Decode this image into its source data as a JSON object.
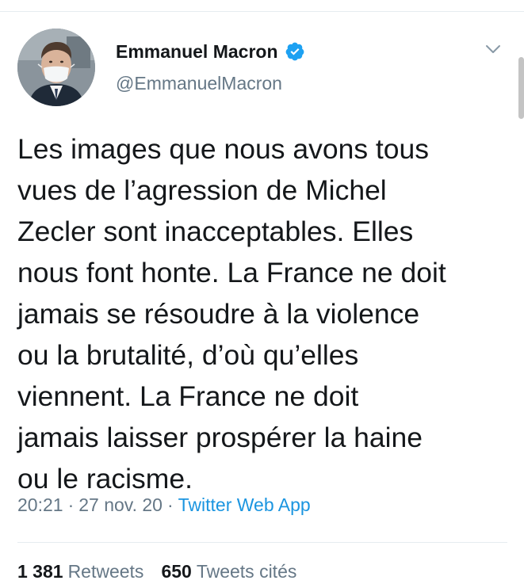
{
  "colors": {
    "link": "#1b95e0",
    "secondary_text": "#657786",
    "primary_text": "#14171a",
    "divider": "#e6ecf0",
    "verified_badge": "#1da1f2"
  },
  "author": {
    "display_name": "Emmanuel Macron",
    "handle": "@EmmanuelMacron",
    "verified": true,
    "avatar_icon": "profile-photo"
  },
  "tweet": {
    "text": "Les images que nous avons tous\nvues de l’agression de Michel\nZecler sont inacceptables. Elles\nnous font honte. La France ne doit\njamais se résoudre à la violence\nou la brutalité, d’où qu’elles\nviennent. La France ne doit\njamais laisser prospérer la haine\nou le racisme.",
    "time": "20:21",
    "date": "27 nov. 20",
    "separator": "·",
    "source": "Twitter Web App"
  },
  "stats": {
    "retweets_count": "1 381",
    "retweets_label": "Retweets",
    "quotes_count": "650",
    "quotes_label": "Tweets cités"
  },
  "icons": {
    "menu": "chevron-down-icon",
    "badge": "verified-badge-icon"
  }
}
